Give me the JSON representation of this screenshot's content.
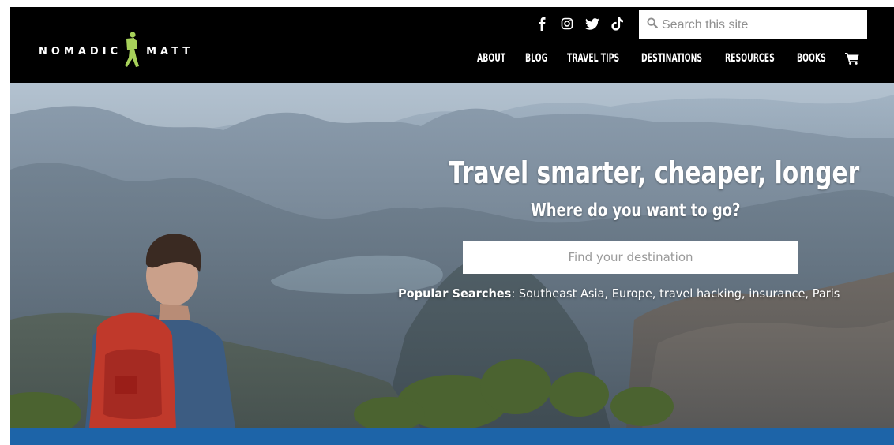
{
  "brand": {
    "left_word": "NOMADIC",
    "right_word": "MATT",
    "logo_color": "#a7d15a"
  },
  "social": {
    "icons": [
      "facebook-icon",
      "instagram-icon",
      "twitter-icon",
      "tiktok-icon"
    ]
  },
  "site_search": {
    "placeholder": "Search this site"
  },
  "nav": {
    "items": [
      {
        "label": "About"
      },
      {
        "label": "Blog"
      },
      {
        "label": "Travel Tips"
      },
      {
        "label": "Destinations"
      },
      {
        "label": "Resources"
      },
      {
        "label": "Books"
      }
    ],
    "cart_icon": "cart-icon"
  },
  "hero": {
    "title": "Travel smarter, cheaper, longer",
    "subtitle": "Where do you want to go?",
    "destination_placeholder": "Find your destination",
    "popular_label": "Popular Searches",
    "popular_items": [
      "Southeast Asia",
      "Europe",
      "travel hacking",
      "insurance",
      "Paris"
    ]
  },
  "colors": {
    "header_bg": "#000000",
    "accent_bar": "#1d64a8",
    "logo_green": "#a7d15a"
  }
}
